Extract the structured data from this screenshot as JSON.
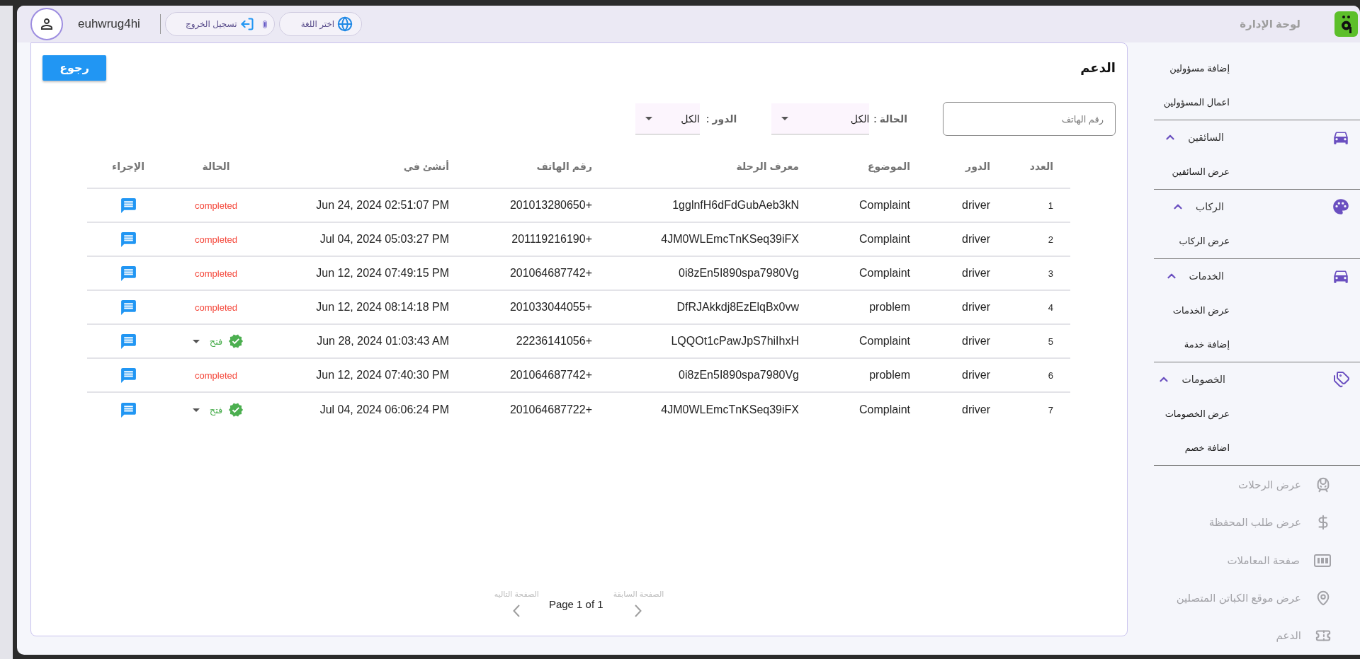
{
  "topbar": {
    "username": "euhwrug4hi",
    "logout": {
      "label": "تسجيل الخروج"
    },
    "language": {
      "label": "اختر اللغة"
    },
    "title": "لوحة الإدارة"
  },
  "page": {
    "title": "الدعم",
    "back_button": "رجوع"
  },
  "filters": {
    "phone": {
      "placeholder": "رقم الهاتف"
    },
    "status": {
      "label": "الحالة :",
      "value": "الكل"
    },
    "role": {
      "label": "الدور :",
      "value": "الكل"
    }
  },
  "table": {
    "columns": [
      "العدد",
      "الدور",
      "الموضوع",
      "معرف الرحلة",
      "رقم الهاتف",
      "أنشئ في",
      "الحالة",
      "الإجراء"
    ],
    "rows": [
      {
        "number": "1",
        "role": "driver",
        "subject": "Complaint",
        "trip_id": "1gglnfH6dFdGubAeb3kN",
        "phone": "201013280650+",
        "created": "Jun 24, 2024 02:51:07 PM",
        "status": {
          "kind": "text",
          "label": "completed"
        }
      },
      {
        "number": "2",
        "role": "driver",
        "subject": "Complaint",
        "trip_id": "4JM0WLEmcTnKSeq39iFX",
        "phone": "201119216190+",
        "created": "Jul 04, 2024 05:03:27 PM",
        "status": {
          "kind": "text",
          "label": "completed"
        }
      },
      {
        "number": "3",
        "role": "driver",
        "subject": "Complaint",
        "trip_id": "0i8zEn5I890spa7980Vg",
        "phone": "201064687742+",
        "created": "Jun 12, 2024 07:49:15 PM",
        "status": {
          "kind": "text",
          "label": "completed"
        }
      },
      {
        "number": "4",
        "role": "driver",
        "subject": "problem",
        "trip_id": "DfRJAkkdj8EzElqBx0vw",
        "phone": "201033044055+",
        "created": "Jun 12, 2024 08:14:18 PM",
        "status": {
          "kind": "text",
          "label": "completed"
        }
      },
      {
        "number": "5",
        "role": "driver",
        "subject": "Complaint",
        "trip_id": "LQQOt1cPawJpS7hiIhxH",
        "phone": "22236141056+",
        "created": "Jun 28, 2024 01:03:43 AM",
        "status": {
          "kind": "select",
          "label": "فتح"
        }
      },
      {
        "number": "6",
        "role": "driver",
        "subject": "problem",
        "trip_id": "0i8zEn5I890spa7980Vg",
        "phone": "201064687742+",
        "created": "Jun 12, 2024 07:40:30 PM",
        "status": {
          "kind": "text",
          "label": "completed"
        }
      },
      {
        "number": "7",
        "role": "driver",
        "subject": "Complaint",
        "trip_id": "4JM0WLEmcTnKSeq39iFX",
        "phone": "201064687722+",
        "created": "Jul 04, 2024 06:06:24 PM",
        "status": {
          "kind": "select",
          "label": "فتح"
        }
      }
    ]
  },
  "pagination": {
    "next": {
      "label": "الصفحة التاليه",
      "disabled": true
    },
    "page_info": "Page 1 of 1",
    "previous": {
      "label": "الصفحة السابقة",
      "disabled": true
    }
  },
  "sidebar": {
    "items": [
      {
        "kind": "link",
        "label": "إضافة مسؤولين"
      },
      {
        "kind": "link",
        "label": "اعمال المسؤولين"
      },
      {
        "kind": "group",
        "label": "السائقين",
        "expanded": true,
        "children": [
          {
            "label": "عرض السائقين"
          }
        ]
      },
      {
        "kind": "group",
        "label": "الركاب",
        "expanded": true,
        "children": [
          {
            "label": "عرض الركاب"
          }
        ]
      },
      {
        "kind": "group",
        "label": "الخدمات",
        "expanded": true,
        "children": [
          {
            "label": "عرض الخدمات"
          },
          {
            "label": "إضافة خدمة"
          }
        ]
      },
      {
        "kind": "group",
        "label": "الخصومات",
        "expanded": true,
        "children": [
          {
            "label": "عرض الخصومات"
          },
          {
            "label": "اضافة خصم"
          }
        ]
      },
      {
        "kind": "page",
        "label": "عرض الرحلات"
      },
      {
        "kind": "page",
        "label": "عرض طلب المحفظة"
      },
      {
        "kind": "page",
        "label": "صفحة المعاملات"
      },
      {
        "kind": "page",
        "label": "عرض موقع الكباتن المتصلين"
      },
      {
        "kind": "page",
        "label": "الدعم"
      }
    ]
  }
}
